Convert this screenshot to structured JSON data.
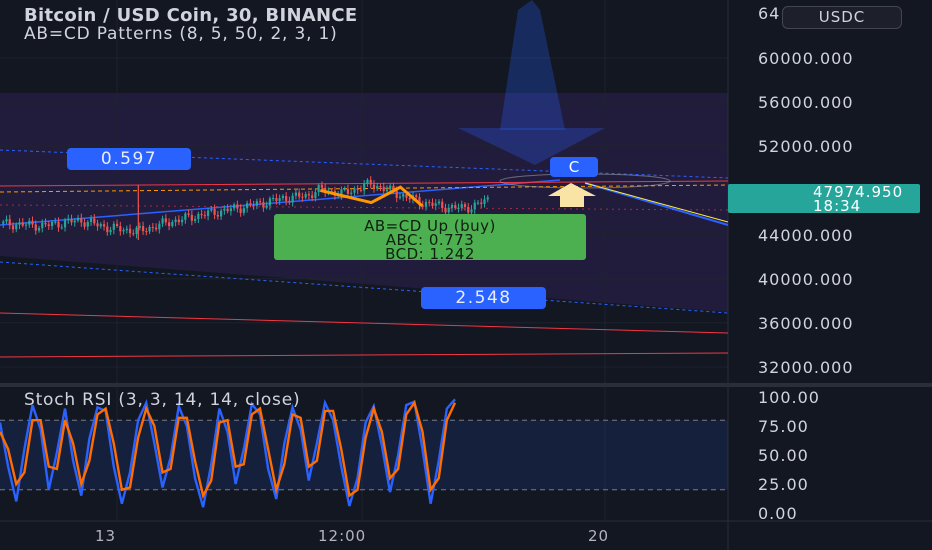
{
  "header": {
    "title": "Bitcoin / USD Coin, 30, BINANCE",
    "indicator": "AB=CD Patterns (8, 5, 50, 2, 3, 1)"
  },
  "currency_badge": "USDC",
  "price_axis": {
    "top_partial": "64",
    "labels": [
      "60000.000",
      "56000.000",
      "52000.000",
      "44000.000",
      "40000.000",
      "36000.000",
      "32000.000"
    ]
  },
  "last_price": {
    "value": "47974.950",
    "countdown": "18:34",
    "color": "#26a69a"
  },
  "fib_labels": {
    "upper": "0.597",
    "lower": "2.548"
  },
  "point_c_label": "C",
  "pattern_label": {
    "line1": "AB=CD  Up (buy)",
    "line2": "ABC: 0.773",
    "line3": "BCD: 1.242",
    "color": "#4caf50"
  },
  "stoch": {
    "title": "Stoch RSI (3, 3, 14, 14, close)",
    "axis_labels": [
      "100.00",
      "75.00",
      "50.00",
      "25.00",
      "0.00"
    ],
    "k_color": "#2962ff",
    "d_color": "#ff6d00"
  },
  "time_axis": {
    "labels": [
      "13",
      "12:00",
      "20"
    ]
  },
  "colors": {
    "background": "#131722",
    "fib_blue": "#2962ff",
    "level_red": "#f23645",
    "candle_up": "#26a69a",
    "candle_down": "#ef5350"
  },
  "chart_data": [
    {
      "type": "candlestick",
      "title": "Bitcoin / USD Coin, 30, BINANCE",
      "ylim": [
        30000,
        65000
      ],
      "y_ticks": [
        32000,
        36000,
        40000,
        44000,
        52000,
        56000,
        60000
      ],
      "last_price": 47974.95,
      "x_tick_labels": [
        "13",
        "12:00",
        "20"
      ],
      "close_path": [
        [
          0,
          45000
        ],
        [
          0.06,
          44800
        ],
        [
          0.11,
          45300
        ],
        [
          0.15,
          44600
        ],
        [
          0.19,
          44300
        ],
        [
          0.23,
          45100
        ],
        [
          0.27,
          45700
        ],
        [
          0.31,
          46200
        ],
        [
          0.35,
          46700
        ],
        [
          0.39,
          47300
        ],
        [
          0.42,
          47500
        ],
        [
          0.44,
          48100
        ],
        [
          0.47,
          47700
        ],
        [
          0.51,
          48600
        ],
        [
          0.55,
          47600
        ],
        [
          0.58,
          46900
        ],
        [
          0.62,
          46400
        ],
        [
          0.65,
          46500
        ],
        [
          0.67,
          47200
        ]
      ],
      "annotations": {
        "fib_ratios": [
          "0.597",
          "2.548"
        ],
        "pattern": "AB=CD  Up (buy)",
        "ABC": 0.773,
        "BCD": 1.242,
        "point": "C"
      }
    },
    {
      "type": "line",
      "title": "Stoch RSI (3, 3, 14, 14, close)",
      "ylim": [
        0,
        100
      ],
      "y_ticks": [
        0,
        25,
        50,
        75,
        100
      ],
      "series": [
        {
          "name": "",
          "values": [
            78,
            40,
            10,
            55,
            93,
            72,
            20,
            52,
            90,
            45,
            15,
            64,
            91,
            88,
            40,
            8,
            35,
            80,
            95,
            60,
            22,
            48,
            92,
            75,
            30,
            5,
            42,
            90,
            70,
            25,
            55,
            94,
            85,
            38,
            12,
            60,
            91,
            72,
            28,
            60,
            95,
            80,
            40,
            6,
            30,
            78,
            92,
            58,
            18,
            50,
            93,
            96,
            55,
            8,
            45,
            90,
            98
          ]
        },
        {
          "name": "",
          "values": [
            70,
            55,
            25,
            35,
            80,
            80,
            40,
            38,
            80,
            60,
            25,
            45,
            85,
            90,
            60,
            20,
            22,
            65,
            90,
            75,
            35,
            38,
            82,
            82,
            45,
            15,
            28,
            78,
            80,
            40,
            42,
            85,
            90,
            55,
            20,
            42,
            85,
            82,
            40,
            45,
            88,
            88,
            55,
            15,
            20,
            65,
            90,
            70,
            30,
            38,
            85,
            95,
            70,
            20,
            30,
            80,
            95
          ]
        }
      ]
    }
  ]
}
